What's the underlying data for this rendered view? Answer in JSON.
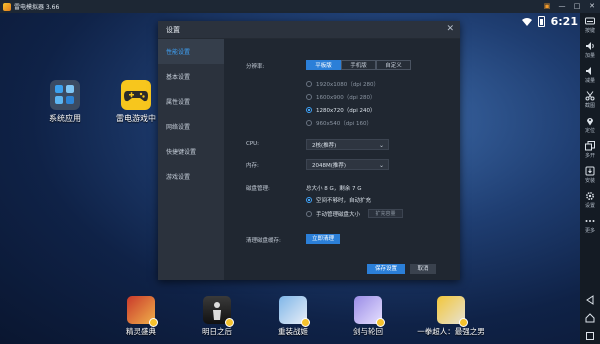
{
  "window": {
    "title": "雷电模拟器 3.66",
    "controls": [
      "▣",
      "—",
      "□",
      "✕"
    ]
  },
  "status": {
    "time": "6:21"
  },
  "sidebar": {
    "items": [
      {
        "label": "按键",
        "icon": "keyboard-icon"
      },
      {
        "label": "加量",
        "icon": "volume-up-icon"
      },
      {
        "label": "减量",
        "icon": "volume-down-icon"
      },
      {
        "label": "截图",
        "icon": "scissors-icon"
      },
      {
        "label": "定位",
        "icon": "location-icon"
      },
      {
        "label": "多开",
        "icon": "multi-window-icon"
      },
      {
        "label": "安装",
        "icon": "install-icon"
      },
      {
        "label": "设置",
        "icon": "gear-icon"
      },
      {
        "label": "更多",
        "icon": "more-icon"
      }
    ],
    "nav_icons": [
      "back-icon",
      "home-icon",
      "recent-apps-icon"
    ]
  },
  "desktop": {
    "apps": [
      {
        "label": "系统应用",
        "icon": "system-apps-folder-icon"
      },
      {
        "label": "雷电游戏中",
        "icon": "gamepad-icon"
      }
    ]
  },
  "dialog": {
    "title": "设置",
    "close": "✕",
    "nav": [
      "性能设置",
      "基本设置",
      "属性设置",
      "网络设置",
      "快捷键设置",
      "游戏设置"
    ],
    "active_nav": 0,
    "resolution": {
      "label": "分辨率:",
      "modes": [
        "平板版",
        "手机版",
        "自定义"
      ],
      "active_mode": 0,
      "options": [
        "1920x1080（dpi 280）",
        "1600x900（dpi 280）",
        "1280x720（dpi 240）",
        "960x540（dpi 160）"
      ],
      "selected": 2
    },
    "cpu": {
      "label": "CPU:",
      "value": "2核(推荐)"
    },
    "memory": {
      "label": "内存:",
      "value": "2048M(推荐)"
    },
    "disk": {
      "label": "磁盘管理:",
      "info": "总大小 8 G，剩余 7 G",
      "options": [
        "空间不够时，自动扩充",
        "手动管理磁盘大小"
      ],
      "selected": 0,
      "expand_btn": "扩充容量"
    },
    "cache": {
      "label": "清理磁盘缓存:",
      "button": "立即清理"
    },
    "save": "保存设置",
    "cancel": "取消"
  },
  "dock": {
    "apps": [
      "精灵盛典",
      "明日之后",
      "重装战姬",
      "剑与轮回",
      "一拳超人：最强之男"
    ]
  }
}
